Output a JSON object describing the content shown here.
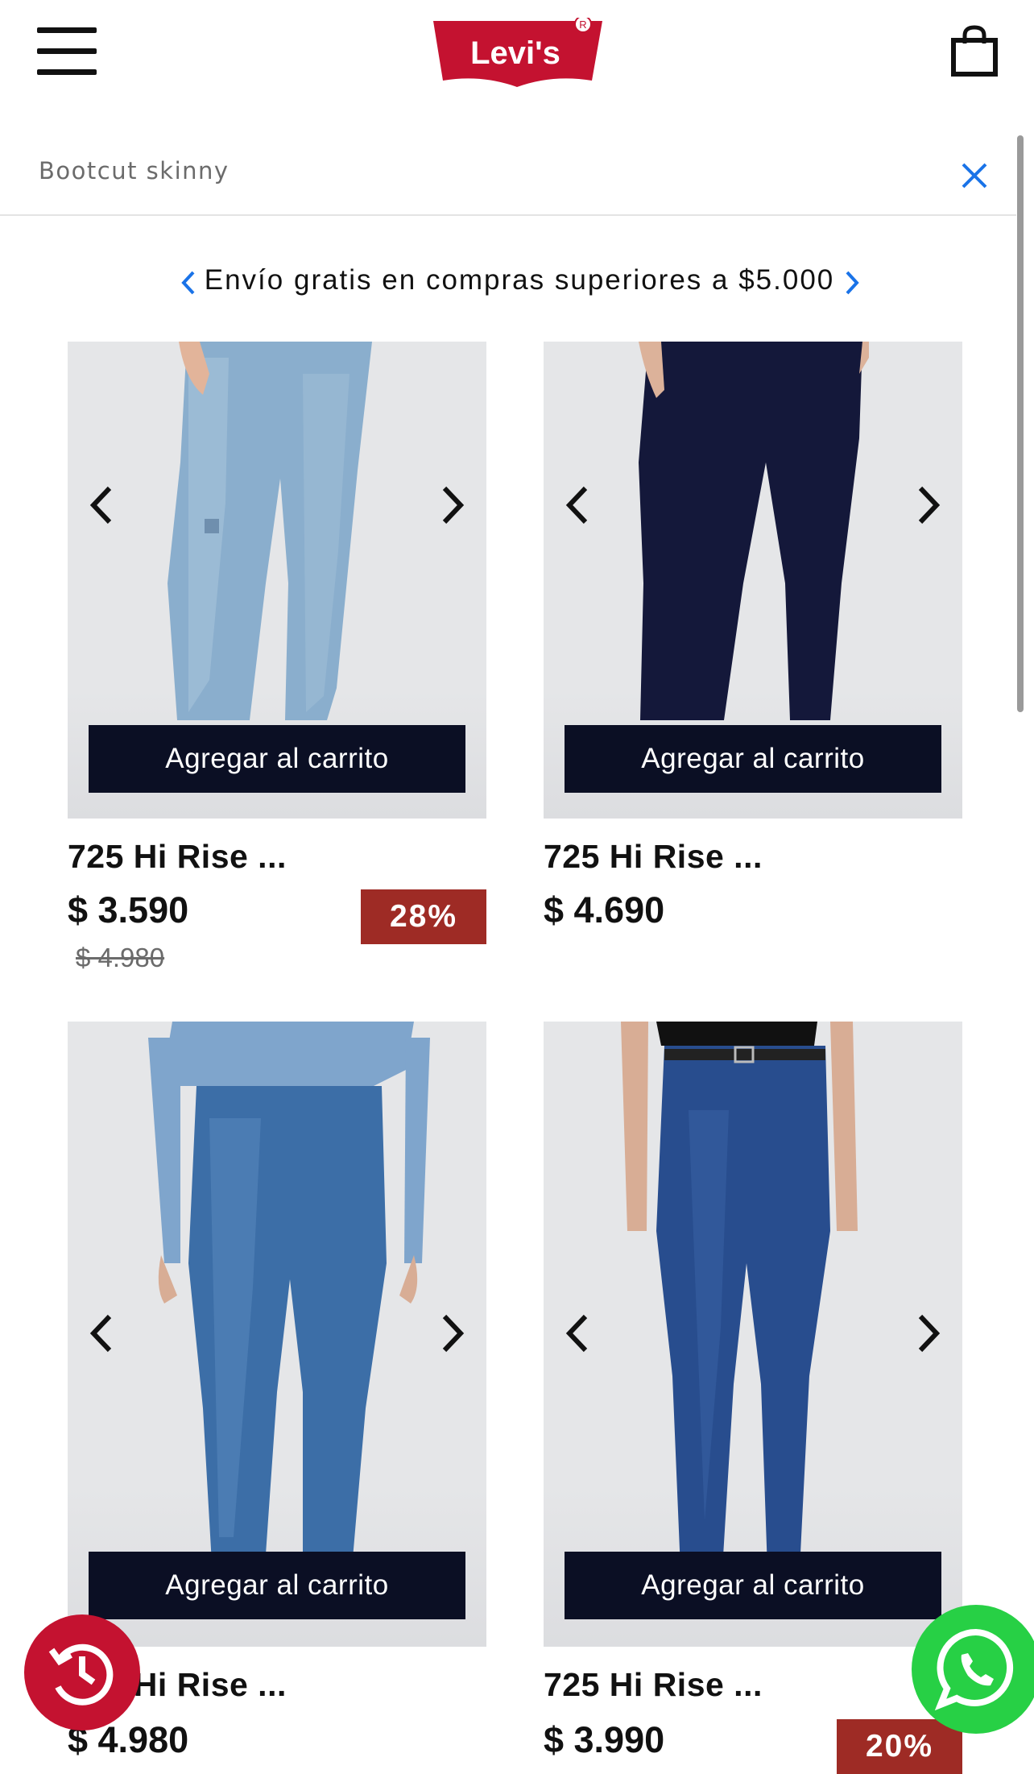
{
  "header": {
    "logo_text": "Levi's",
    "logo_icon": "levis-batwing-logo",
    "menu_icon": "hamburger-menu-icon",
    "cart_icon": "shopping-bag-icon"
  },
  "search": {
    "value": "Bootcut skinny",
    "clear_icon": "close-icon"
  },
  "promo": {
    "text": "Envío gratis en compras superiores a $5.000"
  },
  "products": [
    {
      "name": "725 Hi Rise ...",
      "price": "$ 3.590",
      "old_price": "$ 4.980",
      "discount": "28%",
      "add_label": "Agregar al carrito",
      "wash": "light"
    },
    {
      "name": "725 Hi Rise ...",
      "price": "$ 4.690",
      "old_price": "",
      "discount": "",
      "add_label": "Agregar al carrito",
      "wash": "dark"
    },
    {
      "name": "725 Hi Rise ...",
      "price": "$ 4.980",
      "old_price": "",
      "discount": "",
      "add_label": "Agregar al carrito",
      "wash": "medium"
    },
    {
      "name": "725 Hi Rise ...",
      "price": "$ 3.990",
      "old_price": "",
      "discount": "20%",
      "add_label": "Agregar al carrito",
      "wash": "deep"
    }
  ],
  "fabs": {
    "history_icon": "history-icon",
    "whatsapp_icon": "whatsapp-icon"
  },
  "colors": {
    "brand_red": "#c41230",
    "button_navy": "#0b0f24",
    "discount_red": "#9e2b25",
    "whatsapp_green": "#27d045",
    "link_blue": "#1a73e8"
  }
}
